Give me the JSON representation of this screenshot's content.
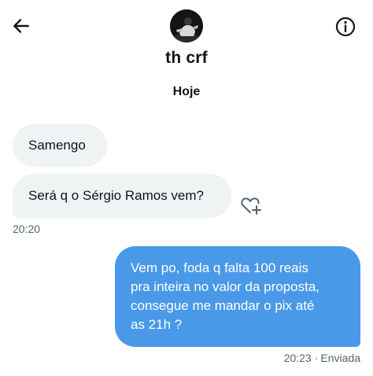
{
  "header": {
    "contact_name": "th crf",
    "back_icon": "arrow-left-icon",
    "info_icon": "info-icon",
    "avatar": "profile-photo"
  },
  "conversation": {
    "date_label": "Hoje",
    "incoming": [
      {
        "text": "Samengo"
      },
      {
        "text": "Será q o Sérgio Ramos vem?"
      }
    ],
    "incoming_time": "20:20",
    "react_icon": "add-reaction-heart-icon",
    "outgoing": {
      "lines": [
        "Vem po, foda q falta 100 reais",
        "pra inteira no valor da proposta,",
        "consegue me mandar o pix até",
        "as 21h ?"
      ],
      "time": "20:23",
      "separator": "·",
      "status": "Enviada"
    }
  },
  "colors": {
    "incoming_bubble": "#eff3f4",
    "outgoing_bubble": "#4a99e9",
    "secondary_text": "#536471"
  }
}
